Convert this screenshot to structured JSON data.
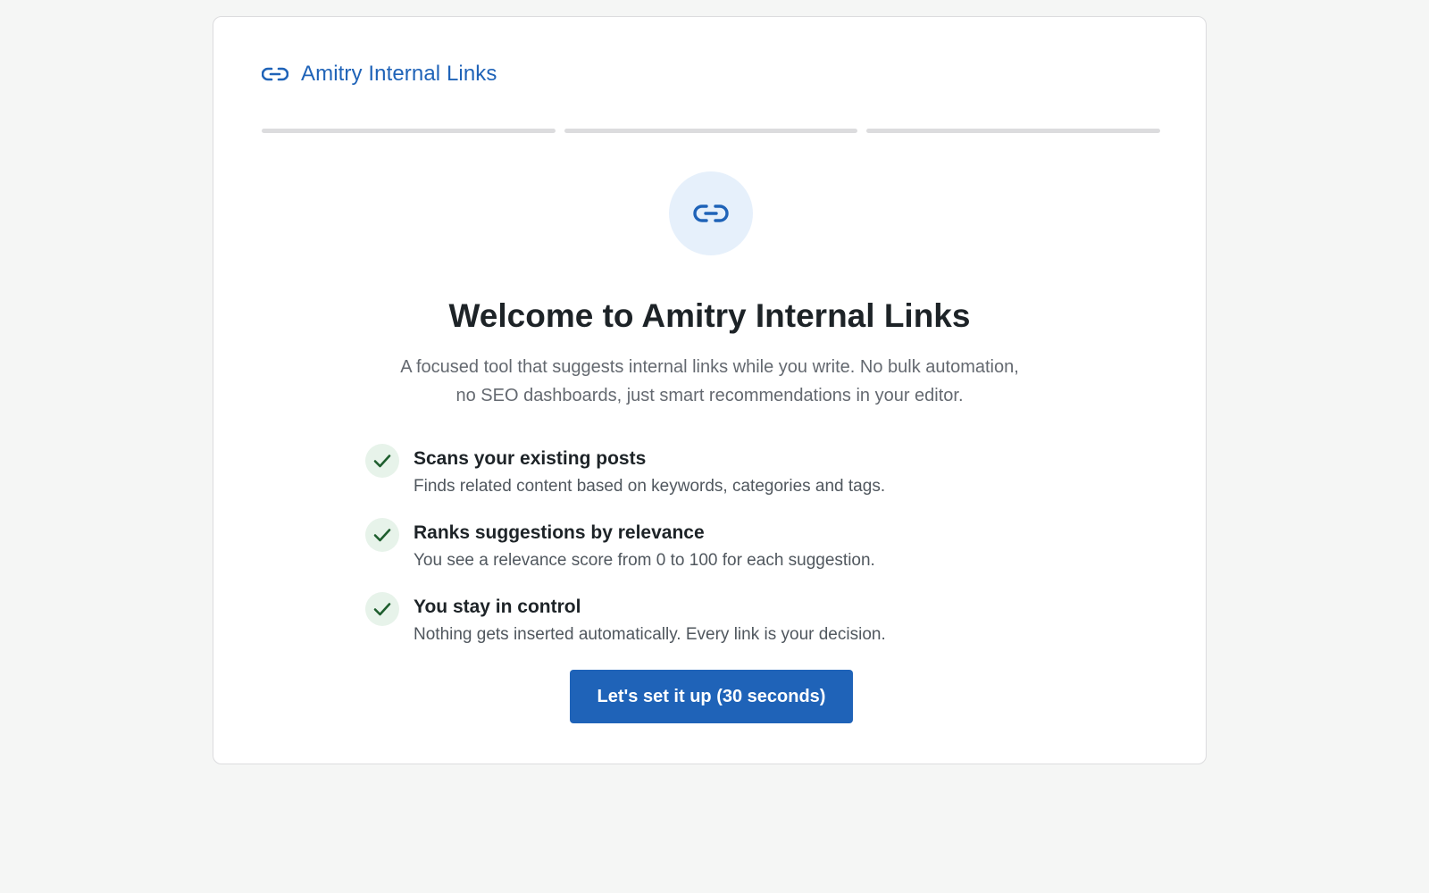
{
  "header": {
    "brand_name": "Amitry Internal Links",
    "brand_icon": "link-icon"
  },
  "progress": {
    "total_steps": 3,
    "completed_steps": 0
  },
  "hero": {
    "icon": "link-icon",
    "title": "Welcome to Amitry Internal Links",
    "subtitle_line1": "A focused tool that suggests internal links while you write. No bulk automation,",
    "subtitle_line2": "no SEO dashboards, just smart recommendations in your editor."
  },
  "features": [
    {
      "icon": "check-icon",
      "title": "Scans your existing posts",
      "description": "Finds related content based on keywords, categories and tags."
    },
    {
      "icon": "check-icon",
      "title": "Ranks suggestions by relevance",
      "description": "You see a relevance score from 0 to 100 for each suggestion."
    },
    {
      "icon": "check-icon",
      "title": "You stay in control",
      "description": "Nothing gets inserted automatically. Every link is your decision."
    }
  ],
  "cta": {
    "label": "Let's set it up (30 seconds)"
  },
  "colors": {
    "accent": "#1f63b8",
    "check_bg": "#e7f3ea",
    "check_fg": "#1e5e2e",
    "hero_icon_bg": "#e6f0fb",
    "step_inactive": "#dcdcde",
    "page_bg": "#f5f6f5"
  }
}
